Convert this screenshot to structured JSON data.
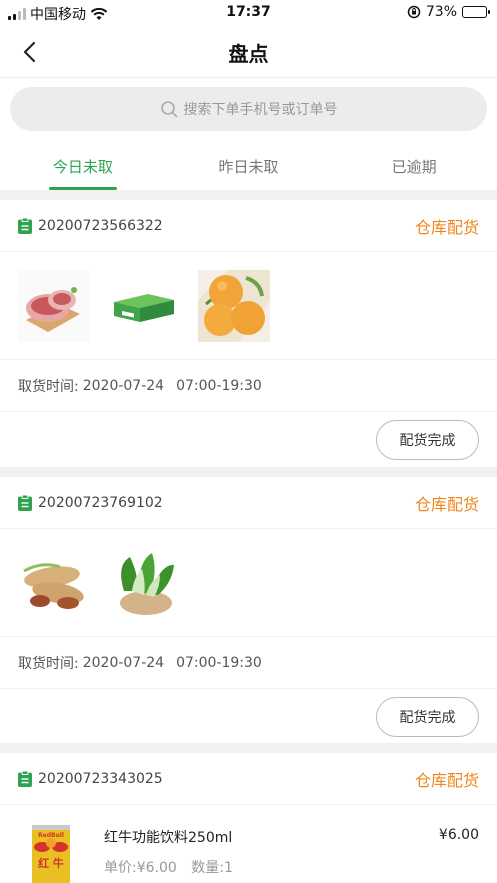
{
  "status_bar": {
    "carrier": "中国移动",
    "time": "17:37",
    "battery": "73%",
    "battery_level": 0.73
  },
  "nav": {
    "title": "盘点"
  },
  "search": {
    "placeholder": "搜索下单手机号或订单号"
  },
  "tabs": [
    {
      "label": "今日未取",
      "active": true
    },
    {
      "label": "昨日未取",
      "active": false
    },
    {
      "label": "已逾期",
      "active": false
    }
  ],
  "orders": [
    {
      "order_no": "20200723566322",
      "status": "仓库配货",
      "pickup_label": "取货时间:",
      "pickup_date": "2020-07-24",
      "pickup_window": "07:00-19:30",
      "action_label": "配货完成",
      "items": [
        "pork",
        "gift-box",
        "oranges"
      ]
    },
    {
      "order_no": "20200723769102",
      "status": "仓库配货",
      "pickup_label": "取货时间:",
      "pickup_date": "2020-07-24",
      "pickup_window": "07:00-19:30",
      "action_label": "配货完成",
      "items": [
        "peanuts",
        "bok-choy"
      ]
    },
    {
      "order_no": "20200723343025",
      "status": "仓库配货",
      "product": {
        "name": "红牛功能饮料250ml",
        "price": "¥6.00",
        "unit_price": "单价:¥6.00",
        "quantity": "数量:1",
        "can_text": "红 牛",
        "can_brand": "RedBull"
      }
    }
  ],
  "colors": {
    "accent": "#2fa352",
    "status": "#f08519"
  }
}
